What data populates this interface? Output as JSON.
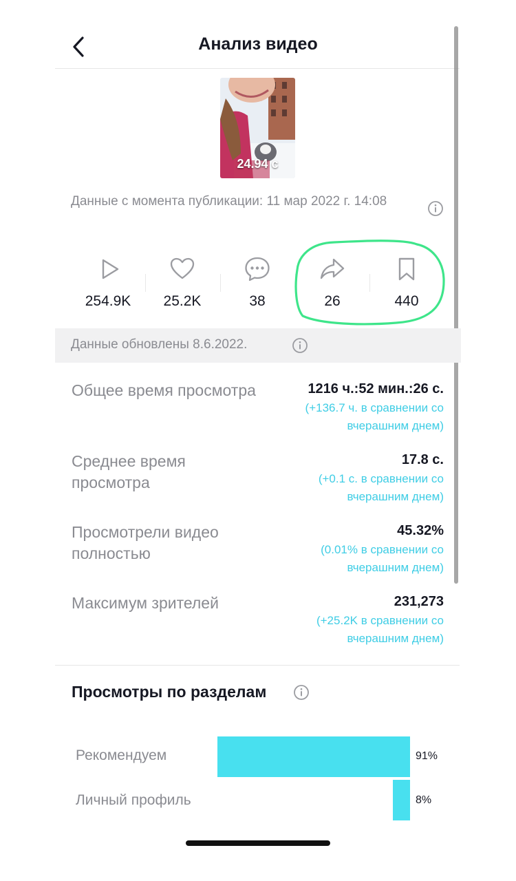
{
  "header": {
    "title": "Анализ видео"
  },
  "video": {
    "duration": "24.94 с"
  },
  "published_text": "Данные с момента публикации: 11 мар 2022 г. 14:08",
  "stats": [
    {
      "icon": "play-icon",
      "value": "254.9K"
    },
    {
      "icon": "heart-icon",
      "value": "25.2K"
    },
    {
      "icon": "comment-icon",
      "value": "38"
    },
    {
      "icon": "share-icon",
      "value": "26"
    },
    {
      "icon": "bookmark-icon",
      "value": "440"
    }
  ],
  "updated_text": "Данные обновлены 8.6.2022.",
  "metrics": [
    {
      "label": "Общее время просмотра",
      "value": "1216 ч.:52 мин.:26 с.",
      "cmp1": "(+136.7 ч. в сравнении со",
      "cmp2": "вчерашним днем)"
    },
    {
      "label": "Среднее время просмотра",
      "value": "17.8 с.",
      "cmp1": "(+0.1 с. в сравнении со",
      "cmp2": "вчерашним днем)"
    },
    {
      "label": "Просмотрели видео полностью",
      "value": "45.32%",
      "cmp1": "(0.01% в сравнении со",
      "cmp2": "вчерашним днем)"
    },
    {
      "label": "Максимум зрителей",
      "value": "231,273",
      "cmp1": "(+25.2K в сравнении со",
      "cmp2": "вчерашним днем)"
    }
  ],
  "sections": {
    "title": "Просмотры по разделам",
    "items": [
      {
        "label": "Рекомендуем",
        "pct_label": "91%",
        "fraction": 0.91
      },
      {
        "label": "Личный профиль",
        "pct_label": "8%",
        "fraction": 0.08
      }
    ]
  },
  "colors": {
    "accent": "#48e0ef",
    "cmp_text": "#3fcde5",
    "highlight": "#3ee58a"
  }
}
